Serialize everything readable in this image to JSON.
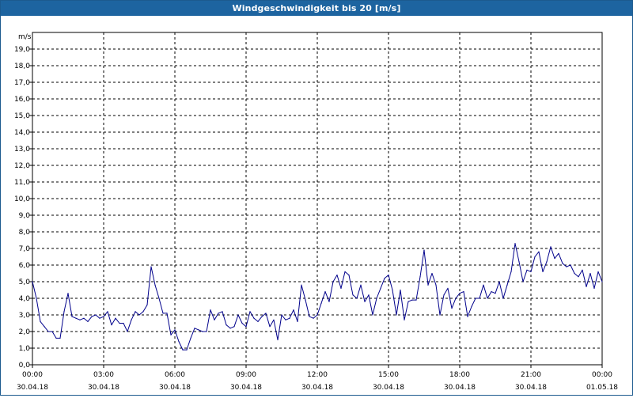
{
  "window": {
    "title": "Windgeschwindigkeit bis 20 [m/s]"
  },
  "colors": {
    "title_bar": "#1d64a0",
    "series_line": "#00008b",
    "grid": "#000000"
  },
  "chart_data": {
    "type": "line",
    "title": "Windgeschwindigkeit bis 20 [m/s]",
    "ylabel": "m/s",
    "xlabel": "",
    "ylim": [
      0,
      20
    ],
    "xlim_hours": [
      0,
      24
    ],
    "grid": true,
    "grid_style": "dashed",
    "y_ticks": [
      "0,0",
      "1,0",
      "2,0",
      "3,0",
      "4,0",
      "5,0",
      "6,0",
      "7,0",
      "8,0",
      "9,0",
      "10,0",
      "11,0",
      "12,0",
      "13,0",
      "14,0",
      "15,0",
      "16,0",
      "17,0",
      "18,0",
      "19,0"
    ],
    "x_ticks": [
      {
        "time": "00:00",
        "date": "30.04.18"
      },
      {
        "time": "03:00",
        "date": "30.04.18"
      },
      {
        "time": "06:00",
        "date": "30.04.18"
      },
      {
        "time": "09:00",
        "date": "30.04.18"
      },
      {
        "time": "12:00",
        "date": "30.04.18"
      },
      {
        "time": "15:00",
        "date": "30.04.18"
      },
      {
        "time": "18:00",
        "date": "30.04.18"
      },
      {
        "time": "21:00",
        "date": "30.04.18"
      },
      {
        "time": "00:00",
        "date": "01.05.18"
      }
    ],
    "series": [
      {
        "x_start": "30.04.18 00:00",
        "interval_minutes": 10,
        "values": [
          5.0,
          4.0,
          2.6,
          2.3,
          2.0,
          2.0,
          1.6,
          1.6,
          3.2,
          4.3,
          2.9,
          2.8,
          2.7,
          2.8,
          2.6,
          2.9,
          3.0,
          2.8,
          2.9,
          3.2,
          2.4,
          2.8,
          2.5,
          2.5,
          2.0,
          2.7,
          3.2,
          3.0,
          3.2,
          3.6,
          5.9,
          4.8,
          4.0,
          3.1,
          3.1,
          1.8,
          2.1,
          1.4,
          0.9,
          0.9,
          1.6,
          2.2,
          2.1,
          2.0,
          2.0,
          3.3,
          2.7,
          3.1,
          3.2,
          2.4,
          2.2,
          2.3,
          3.0,
          2.5,
          2.3,
          3.2,
          2.8,
          2.6,
          2.9,
          3.1,
          2.3,
          2.7,
          1.5,
          3.0,
          2.7,
          2.8,
          3.3,
          2.6,
          4.8,
          3.9,
          2.9,
          2.8,
          3.0,
          3.7,
          4.4,
          3.8,
          5.0,
          5.4,
          4.6,
          5.6,
          5.4,
          4.2,
          4.0,
          4.8,
          3.8,
          4.2,
          3.0,
          4.0,
          4.6,
          5.2,
          5.4,
          4.5,
          3.0,
          4.5,
          2.7,
          3.8,
          3.9,
          3.9,
          5.3,
          6.9,
          4.8,
          5.5,
          4.8,
          3.0,
          4.2,
          4.6,
          3.4,
          4.0,
          4.3,
          4.4,
          2.9,
          3.5,
          4.0,
          4.0,
          4.8,
          4.0,
          4.4,
          4.3,
          5.0,
          4.0,
          4.8,
          5.6,
          7.3,
          6.2,
          5.0,
          5.7,
          5.6,
          6.5,
          6.8,
          5.6,
          6.2,
          7.1,
          6.4,
          6.7,
          6.1,
          5.9,
          6.0,
          5.5,
          5.3,
          5.7,
          4.7,
          5.5,
          4.6,
          5.6,
          5.0
        ]
      }
    ]
  }
}
